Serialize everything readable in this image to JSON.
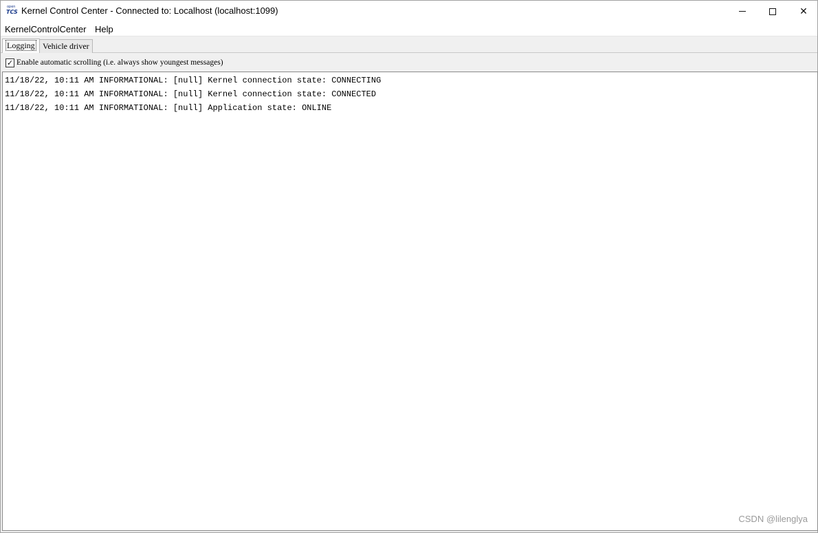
{
  "window": {
    "title": "Kernel Control Center - Connected to: Localhost (localhost:1099)",
    "icon_small": "open",
    "icon_big": "TCS",
    "minimize_icon": "minimize-icon",
    "maximize_icon": "maximize-icon",
    "close_glyph": "✕"
  },
  "menu": {
    "items": [
      {
        "label": "KernelControlCenter"
      },
      {
        "label": "Help"
      }
    ]
  },
  "tabs": [
    {
      "label": "Logging",
      "active": true
    },
    {
      "label": "Vehicle driver",
      "active": false
    }
  ],
  "options": {
    "auto_scroll_checked": true,
    "check_glyph": "✓",
    "auto_scroll_label": "Enable automatic scrolling (i.e. always show youngest messages)"
  },
  "log": {
    "lines": [
      "11/18/22, 10:11 AM INFORMATIONAL: [null] Kernel connection state: CONNECTING",
      "11/18/22, 10:11 AM INFORMATIONAL: [null] Kernel connection state: CONNECTED",
      "11/18/22, 10:11 AM INFORMATIONAL: [null] Application state: ONLINE"
    ]
  },
  "watermark": "CSDN @lilenglya"
}
